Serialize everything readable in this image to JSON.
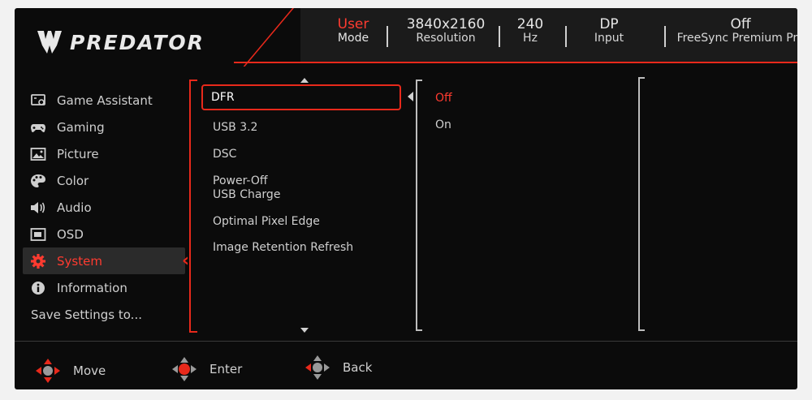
{
  "brand": {
    "logo_text": "PREDATOR"
  },
  "status": {
    "mode": {
      "value": "User",
      "label": "Mode"
    },
    "resolution": {
      "value": "3840x2160",
      "label": "Resolution"
    },
    "refresh": {
      "value": "240",
      "label": "Hz"
    },
    "input": {
      "value": "DP",
      "label": "Input"
    },
    "freesync": {
      "value": "Off",
      "label": "FreeSync Premium Pro"
    }
  },
  "menu": {
    "items": [
      {
        "label": "Game Assistant",
        "icon": "game-assistant-icon"
      },
      {
        "label": "Gaming",
        "icon": "gamepad-icon"
      },
      {
        "label": "Picture",
        "icon": "picture-icon"
      },
      {
        "label": "Color",
        "icon": "palette-icon"
      },
      {
        "label": "Audio",
        "icon": "speaker-icon"
      },
      {
        "label": "OSD",
        "icon": "osd-icon"
      },
      {
        "label": "System",
        "icon": "gear-icon",
        "active": true
      },
      {
        "label": "Information",
        "icon": "info-icon"
      },
      {
        "label": "Save Settings to..."
      }
    ]
  },
  "submenu": {
    "items": [
      {
        "label": "DFR",
        "selected": true
      },
      {
        "label": "USB 3.2"
      },
      {
        "label": "DSC"
      },
      {
        "label": "Power-Off",
        "label2": "USB Charge"
      },
      {
        "label": "Optimal Pixel Edge"
      },
      {
        "label": "Image Retention Refresh"
      }
    ]
  },
  "options": {
    "items": [
      {
        "label": "Off",
        "selected": true
      },
      {
        "label": "On"
      }
    ]
  },
  "footer": {
    "move": "Move",
    "enter": "Enter",
    "back": "Back"
  },
  "colors": {
    "accent": "#e8291b",
    "background": "#0b0b0b",
    "active_bg": "#2b2b2b"
  }
}
